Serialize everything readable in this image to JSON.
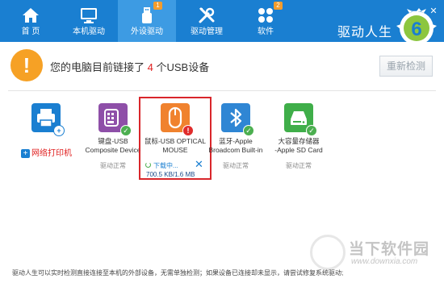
{
  "nav": {
    "items": [
      {
        "label": "首 页",
        "icon": "home-icon",
        "active": false
      },
      {
        "label": "本机驱动",
        "icon": "monitor-icon",
        "active": false
      },
      {
        "label": "外设驱动",
        "icon": "usb-icon",
        "active": true,
        "badge": "1"
      },
      {
        "label": "驱动管理",
        "icon": "tools-icon",
        "active": false
      },
      {
        "label": "软件",
        "icon": "apps-icon",
        "active": false,
        "badge": "2"
      }
    ],
    "window_controls": {
      "minimize": "—",
      "close": "✕"
    }
  },
  "brand": {
    "name": "驱动人生",
    "logo_digit": "6"
  },
  "info": {
    "prefix": "您的电脑目前链接了",
    "count": "4",
    "suffix": "个USB设备",
    "recheck_label": "重新检测"
  },
  "devices": [
    {
      "name_line1": "",
      "name_line2": "",
      "status": "",
      "icon": "printer-icon",
      "extra_label": "网络打印机"
    },
    {
      "name_line1": "键盘-USB",
      "name_line2": "Composite Device",
      "status": "驱动正常",
      "icon": "keyboard-icon"
    },
    {
      "name_line1": "鼠标-USB OPTICAL",
      "name_line2": "MOUSE",
      "status": "",
      "icon": "mouse-icon"
    },
    {
      "name_line1": "蓝牙-Apple",
      "name_line2": "Broadcom Built-in",
      "status": "驱动正常",
      "icon": "bluetooth-icon"
    },
    {
      "name_line1": "大容量存储器",
      "name_line2": "-Apple SD Card",
      "status": "驱动正常",
      "icon": "storage-icon"
    }
  ],
  "download": {
    "status": "下载中...",
    "size": "700.5 KB/1.6 MB"
  },
  "footer": "驱动人生可以实时检测直接连接至本机的外部设备，无需单独检测；如果设备已连接却未显示，请尝试修复系统驱动;",
  "watermark": {
    "name": "当下软件园",
    "url": "www.downxia.com"
  },
  "colors": {
    "nav_bg": "#1a7fd1",
    "nav_active": "#3d9be3",
    "alert": "#f6a125",
    "highlight": "#d9262b"
  }
}
